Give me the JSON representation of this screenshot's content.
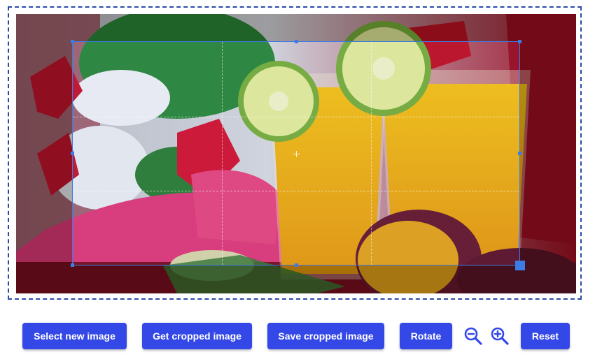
{
  "toolbar": {
    "select_label": "Select new image",
    "get_label": "Get cropped image",
    "save_label": "Save cropped image",
    "rotate_label": "Rotate",
    "reset_label": "Reset",
    "zoom_out_icon": "zoom-out-icon",
    "zoom_in_icon": "zoom-in-icon"
  },
  "colors": {
    "accent": "#3448e8",
    "crop_border": "#3d7be5",
    "frame_border": "#2b4aa8"
  }
}
